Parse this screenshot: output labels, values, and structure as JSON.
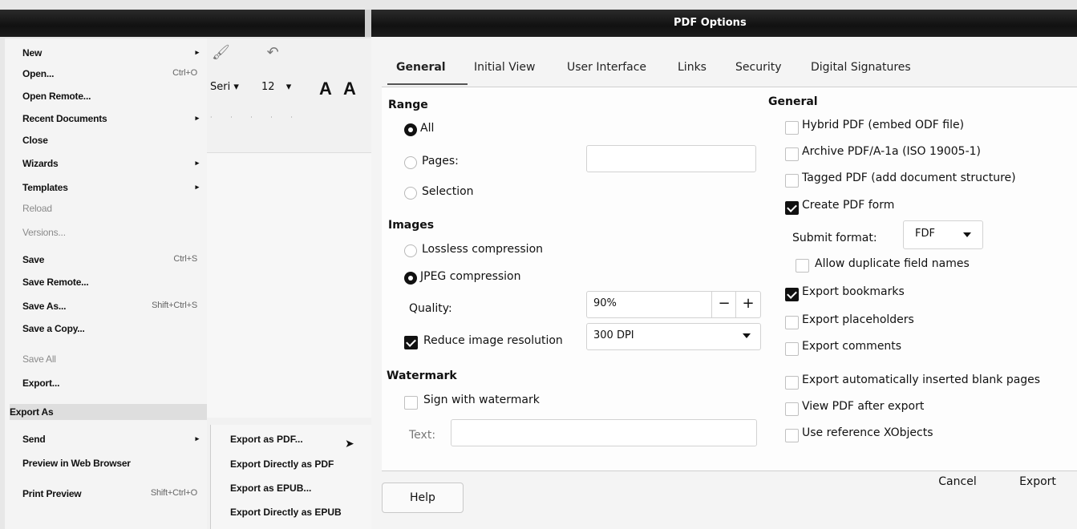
{
  "dialog": {
    "title": "PDF Options"
  },
  "file_menu": {
    "items": [
      {
        "label": "New",
        "shortcut": "",
        "arrow": "▸",
        "disabled": false
      },
      {
        "label": "Open...",
        "shortcut": "Ctrl+O",
        "arrow": "",
        "disabled": false
      },
      {
        "label": "Open Remote...",
        "shortcut": "",
        "arrow": "",
        "disabled": false
      },
      {
        "label": "Recent Documents",
        "shortcut": "",
        "arrow": "▸",
        "disabled": false
      },
      {
        "label": "Close",
        "shortcut": "",
        "arrow": "",
        "disabled": false
      },
      {
        "label": "Wizards",
        "shortcut": "",
        "arrow": "▸",
        "disabled": false
      },
      {
        "label": "Templates",
        "shortcut": "",
        "arrow": "▸",
        "disabled": false
      },
      {
        "label": "Reload",
        "shortcut": "",
        "arrow": "",
        "disabled": true
      },
      {
        "label": "Versions...",
        "shortcut": "",
        "arrow": "",
        "disabled": true
      },
      {
        "label": "Save",
        "shortcut": "Ctrl+S",
        "arrow": "",
        "disabled": false
      },
      {
        "label": "Save Remote...",
        "shortcut": "",
        "arrow": "",
        "disabled": false
      },
      {
        "label": "Save As...",
        "shortcut": "Shift+Ctrl+S",
        "arrow": "",
        "disabled": false
      },
      {
        "label": "Save a Copy...",
        "shortcut": "",
        "arrow": "",
        "disabled": false
      },
      {
        "label": "Save All",
        "shortcut": "",
        "arrow": "",
        "disabled": true
      },
      {
        "label": "Export...",
        "shortcut": "",
        "arrow": "",
        "disabled": false
      },
      {
        "label": "Export As",
        "shortcut": "",
        "arrow": "▸",
        "disabled": false
      },
      {
        "label": "Send",
        "shortcut": "",
        "arrow": "▸",
        "disabled": false
      },
      {
        "label": "Preview in Web Browser",
        "shortcut": "",
        "arrow": "",
        "disabled": false
      },
      {
        "label": "Print Preview",
        "shortcut": "Shift+Ctrl+O",
        "arrow": "",
        "disabled": false
      }
    ]
  },
  "toolbar": {
    "font_name": "Seri",
    "font_size": "12",
    "grow_font": "A",
    "shrink_font": "A"
  },
  "export_as_submenu": {
    "items": [
      "Export as PDF...",
      "Export Directly as PDF",
      "Export as EPUB...",
      "Export Directly as EPUB"
    ]
  },
  "tabs": [
    "General",
    "Initial View",
    "User Interface",
    "Links",
    "Security",
    "Digital Signatures"
  ],
  "range": {
    "heading": "Range",
    "all": "All",
    "pages": "Pages:",
    "selection": "Selection",
    "selected": "All"
  },
  "images": {
    "heading": "Images",
    "lossless": "Lossless compression",
    "jpeg": "JPEG compression",
    "selected": "JPEG compression",
    "quality_label": "Quality:",
    "quality_value": "90%",
    "minus": "−",
    "plus": "+",
    "reduce_label": "Reduce image resolution",
    "reduce_checked": true,
    "resolution_value": "300 DPI"
  },
  "watermark": {
    "heading": "Watermark",
    "sign_label": "Sign with watermark",
    "sign_checked": false,
    "text_label": "Text:",
    "text_value": ""
  },
  "general": {
    "heading": "General",
    "hybrid": {
      "label": "Hybrid PDF (embed ODF file)",
      "checked": false
    },
    "archive": {
      "label": "Archive PDF/A-1a (ISO 19005-1)",
      "checked": false
    },
    "tagged": {
      "label": "Tagged PDF (add document structure)",
      "checked": false
    },
    "create_form": {
      "label": "Create PDF form",
      "checked": true
    },
    "submit_format_label": "Submit format:",
    "submit_format_value": "FDF",
    "allow_duplicate": {
      "label": "Allow duplicate field names",
      "checked": false
    },
    "export_bookmarks": {
      "label": "Export bookmarks",
      "checked": true
    },
    "export_placeholders": {
      "label": "Export placeholders",
      "checked": false
    },
    "export_comments": {
      "label": "Export comments",
      "checked": false
    },
    "export_blank": {
      "label": "Export automatically inserted blank pages",
      "checked": false
    },
    "view_after": {
      "label": "View PDF after export",
      "checked": false
    },
    "reference_xobjects": {
      "label": "Use reference XObjects",
      "checked": false
    }
  },
  "buttons": {
    "help": "Help",
    "cancel": "Cancel",
    "export": "Export"
  }
}
